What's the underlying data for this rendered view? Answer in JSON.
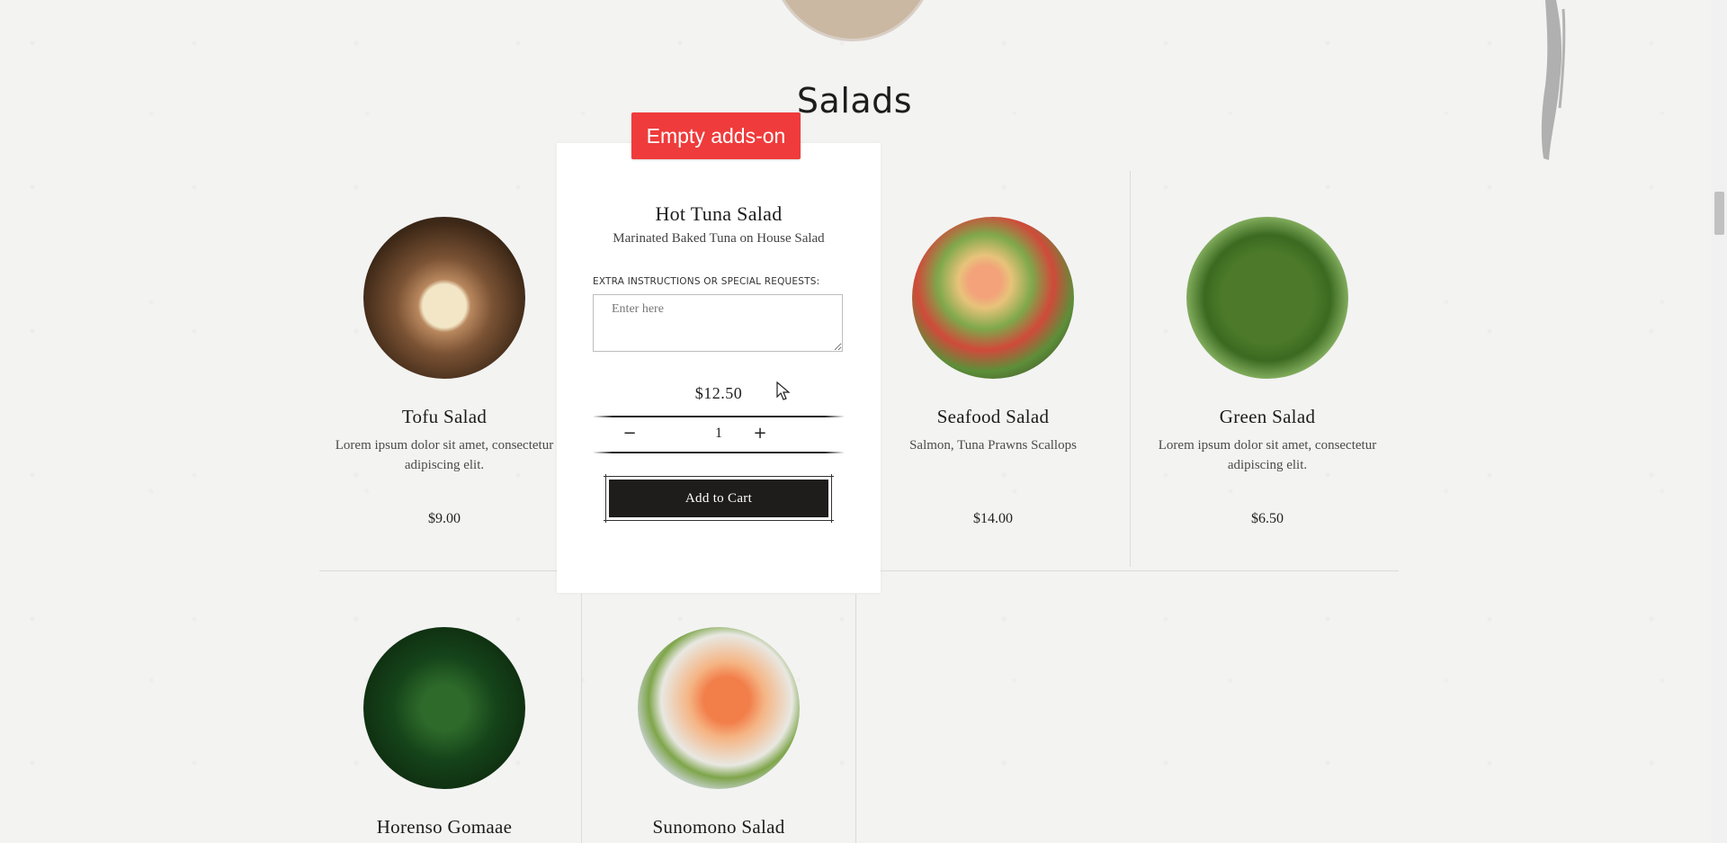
{
  "section": {
    "title": "Salads"
  },
  "items": [
    {
      "name": "Tofu Salad",
      "desc": "Lorem ipsum dolor sit amet, consectetur adipiscing elit.",
      "price": "$9.00"
    },
    {
      "name": "Seafood Salad",
      "desc": "Salmon, Tuna Prawns Scallops",
      "price": "$14.00"
    },
    {
      "name": "Green Salad",
      "desc": "Lorem ipsum dolor sit amet, consectetur adipiscing elit.",
      "price": "$6.50"
    },
    {
      "name": "Horenso Gomaae",
      "desc": "",
      "price": ""
    },
    {
      "name": "Sunomono Salad",
      "desc": "",
      "price": ""
    }
  ],
  "popup": {
    "title": "Hot Tuna Salad",
    "subtitle": "Marinated Baked Tuna on House Salad",
    "instructions_label": "EXTRA INSTRUCTIONS OR SPECIAL REQUESTS:",
    "instructions_placeholder": "Enter here",
    "price": "$12.50",
    "quantity": "1",
    "minus": "−",
    "plus": "+",
    "add_to_cart": "Add to Cart"
  },
  "badge": {
    "text": "Empty adds-on",
    "color": "#ef3b3b"
  }
}
